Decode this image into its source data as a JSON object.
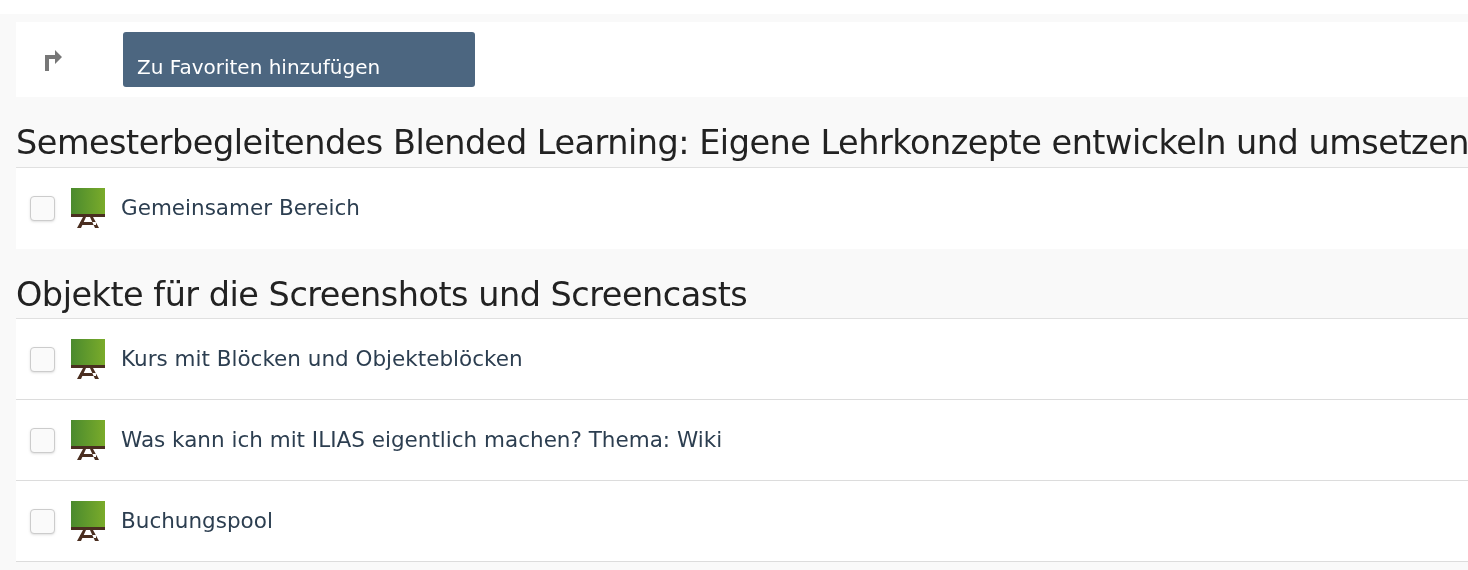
{
  "toolbar": {
    "button": "Zu Favoriten hinzufügen"
  },
  "sections": [
    {
      "title": "Semesterbegleitendes Blended Learning: Eigene Lehrkonzepte entwickeln und umsetzen",
      "items": [
        {
          "label": "Gemeinsamer Bereich",
          "checked": false
        }
      ]
    },
    {
      "title": "Objekte für die Screenshots und Screencasts",
      "items": [
        {
          "label": "Kurs mit Blöcken und Objekteblöcken",
          "checked": false
        },
        {
          "label": "Was kann ich mit ILIAS eigentlich machen? Thema: Wiki",
          "checked": false
        },
        {
          "label": "Buchungspool",
          "checked": false
        }
      ]
    }
  ]
}
